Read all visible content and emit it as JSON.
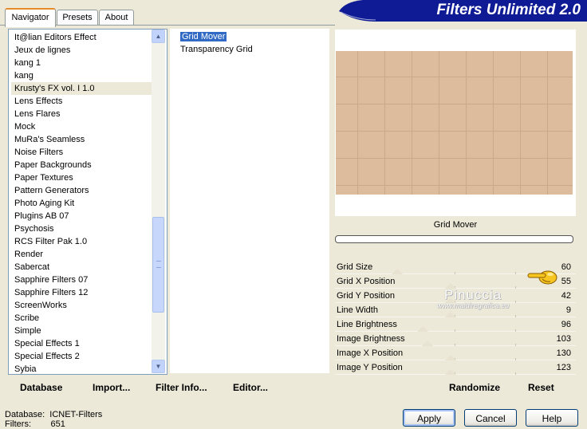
{
  "tabs": [
    {
      "label": "Navigator",
      "active": true
    },
    {
      "label": "Presets",
      "active": false
    },
    {
      "label": "About",
      "active": false
    }
  ],
  "header": {
    "title": "Filters Unlimited 2.0"
  },
  "categories": {
    "items": [
      "It@lian Editors Effect",
      "Jeux de lignes",
      "kang 1",
      "kang",
      "Krusty's FX vol. I 1.0",
      "Lens Effects",
      "Lens Flares",
      "Mock",
      "MuRa's Seamless",
      "Noise Filters",
      "Paper Backgrounds",
      "Paper Textures",
      "Pattern Generators",
      "Photo Aging Kit",
      "Plugins AB 07",
      "Psychosis",
      "RCS Filter Pak 1.0",
      "Render",
      "Sabercat",
      "Sapphire Filters 07",
      "Sapphire Filters 12",
      "ScreenWorks",
      "Scribe",
      "Simple",
      "Special Effects 1",
      "Special Effects 2",
      "Sybia"
    ],
    "selected_index": 4
  },
  "filters": {
    "items": [
      "Grid Mover",
      "Transparency Grid"
    ],
    "selected_index": 0
  },
  "preview": {
    "filter_name": "Grid Mover",
    "colors": {
      "background": "#dcbc9c",
      "grid": "#caa88a"
    }
  },
  "params": [
    {
      "label": "Grid Size",
      "value": "60",
      "level": 0.27
    },
    {
      "label": "Grid X Position",
      "value": "55",
      "level": 0.5
    },
    {
      "label": "Grid Y Position",
      "value": "42",
      "level": 0.5
    },
    {
      "label": "Line Width",
      "value": "9",
      "level": 0.5
    },
    {
      "label": "Line Brightness",
      "value": "96",
      "level": 0.38
    },
    {
      "label": "Image Brightness",
      "value": "103",
      "level": 0.4
    },
    {
      "label": "Image X Position",
      "value": "130",
      "level": 0.5
    },
    {
      "label": "Image Y Position",
      "value": "123",
      "level": 0.5
    }
  ],
  "watermark": {
    "title": "Pinuccia",
    "url": "www.maidiregrafica.eu"
  },
  "toolbar": {
    "database": "Database",
    "import": "Import...",
    "filter_info": "Filter Info...",
    "editor": "Editor...",
    "randomize": "Randomize",
    "reset": "Reset"
  },
  "buttons": {
    "apply": "Apply",
    "cancel": "Cancel",
    "help": "Help"
  },
  "status": {
    "database_label": "Database:",
    "database_value": "ICNET-Filters",
    "filters_label": "Filters:",
    "filters_value": "651"
  },
  "colors": {
    "accent": "#e68b2c",
    "header_blue": "#0e1b95",
    "selection": "#316ac5"
  },
  "icons": {
    "hand": "pointing-hand-icon",
    "up": "scroll-up-icon",
    "down": "scroll-down-icon"
  }
}
